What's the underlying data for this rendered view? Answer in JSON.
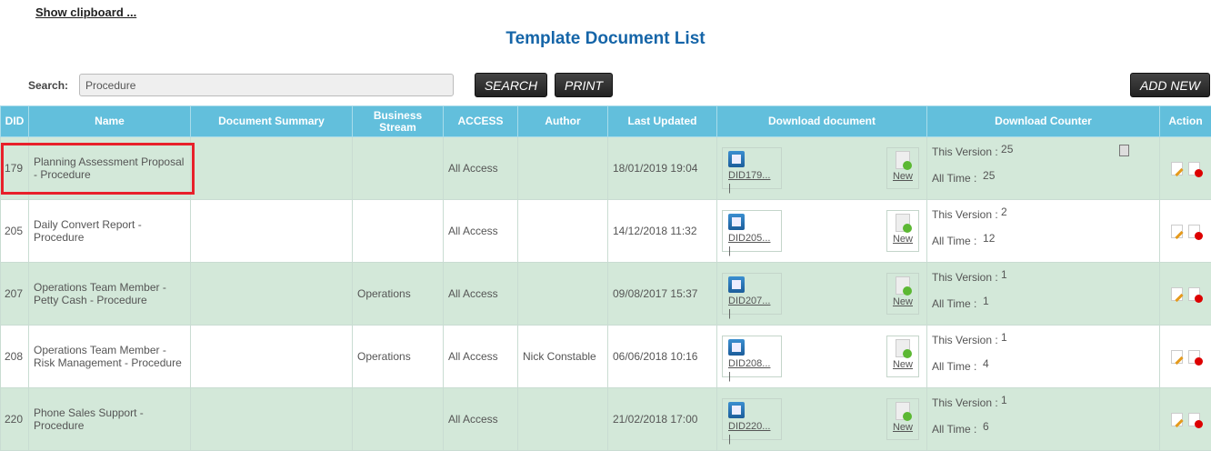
{
  "header": {
    "clipboard_link": "Show clipboard ...",
    "title": "Template Document List"
  },
  "search": {
    "label": "Search:",
    "value": "Procedure",
    "search_button": "SEARCH",
    "print_button": "PRINT",
    "add_new_button": "ADD NEW"
  },
  "columns": [
    "DID",
    "Name",
    "Document Summary",
    "Business Stream",
    "ACCESS",
    "Author",
    "Last Updated",
    "Download document",
    "Download Counter",
    "Action"
  ],
  "counter_labels": {
    "this_version": "This Version :",
    "all_time": "All Time :"
  },
  "new_label": "New",
  "rows": [
    {
      "did": "179",
      "name": "Planning Assessment Proposal - Procedure",
      "summary": "",
      "stream": "",
      "access": "All Access",
      "author": "",
      "updated": "18/01/2019 19:04",
      "doc": "DID179... |",
      "this_version": "25",
      "all_time": "25",
      "highlighted": true
    },
    {
      "did": "205",
      "name": "Daily Convert Report - Procedure",
      "summary": "",
      "stream": "",
      "access": "All Access",
      "author": "",
      "updated": "14/12/2018 11:32",
      "doc": "DID205... |",
      "this_version": "2",
      "all_time": "12"
    },
    {
      "did": "207",
      "name": "Operations Team Member - Petty Cash - Procedure",
      "summary": "",
      "stream": "Operations",
      "access": "All Access",
      "author": "",
      "updated": "09/08/2017 15:37",
      "doc": "DID207... |",
      "this_version": "1",
      "all_time": "1"
    },
    {
      "did": "208",
      "name": "Operations Team Member - Risk Management - Procedure",
      "summary": "",
      "stream": "Operations",
      "access": "All Access",
      "author": "Nick Constable",
      "updated": "06/06/2018 10:16",
      "doc": "DID208... |",
      "this_version": "1",
      "all_time": "4"
    },
    {
      "did": "220",
      "name": "Phone Sales Support - Procedure",
      "summary": "",
      "stream": "",
      "access": "All Access",
      "author": "",
      "updated": "21/02/2018 17:00",
      "doc": "DID220... |",
      "this_version": "1",
      "all_time": "6"
    }
  ],
  "colors": {
    "header_bg": "#62bfdc",
    "row_alt": "#d3e8d9",
    "title": "#1565a8",
    "highlight": "#e8202a"
  }
}
